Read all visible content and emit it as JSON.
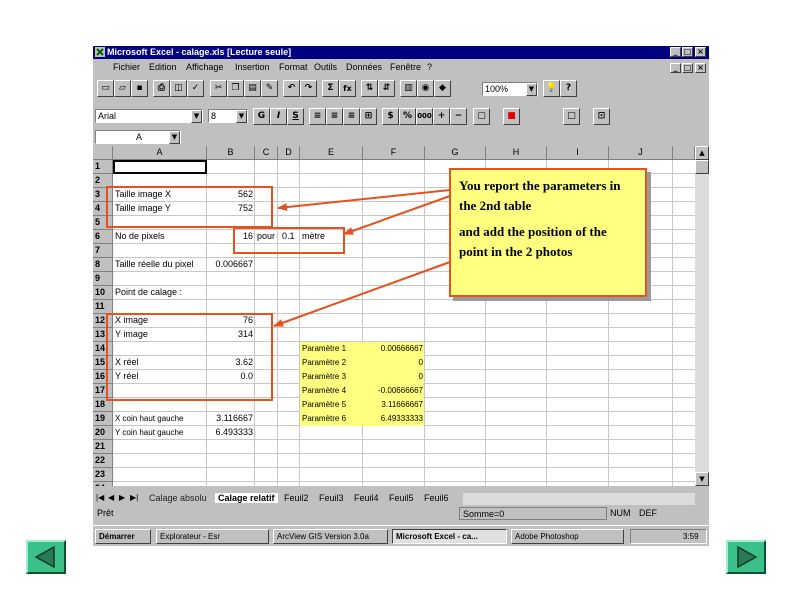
{
  "window": {
    "title": "Microsoft Excel - calage.xls  [Lecture seule]",
    "min_glyph": "_",
    "max_glyph": "□",
    "close_glyph": "×"
  },
  "menu": [
    "Fichier",
    "Edition",
    "Affichage",
    "Insertion",
    "Format",
    "Outils",
    "Données",
    "Fenêtre",
    "?"
  ],
  "toolbar": {
    "zoom": "100%",
    "sum": "Σ",
    "fx": "fx",
    "help": "?"
  },
  "format": {
    "font": "Arial",
    "size": "8",
    "bold": "G",
    "italic": "I",
    "underline": "S",
    "percent": "%",
    "thousands": "000"
  },
  "formula": {
    "cell_ref": "A"
  },
  "columns": [
    "A",
    "B",
    "C",
    "D",
    "E",
    "F",
    "G",
    "H",
    "I",
    "J"
  ],
  "rows": [
    "1",
    "2",
    "3",
    "4",
    "5",
    "6",
    "7",
    "8",
    "9",
    "10",
    "11",
    "12",
    "13",
    "14",
    "15",
    "16",
    "17",
    "18",
    "19",
    "20",
    "21",
    "22",
    "23",
    "24"
  ],
  "cells": {
    "a3": "Taille image X",
    "b3": "562",
    "a4": "Taille image Y",
    "b4": "752",
    "a6": "No de pixels",
    "b6": "16",
    "c6": "pour",
    "d6": "0.1",
    "e6": "mètre",
    "a8": "Taille réelle du pixel",
    "b8": "0.006667",
    "a10": "Point de calage :",
    "a12": "X image",
    "b12": "76",
    "a13": "Y image",
    "b13": "314",
    "a15": "X réel",
    "b15": "3.62",
    "a16": "Y réel",
    "b16": "0.0",
    "a19": "X coin haut gauche",
    "b19": "3.116667",
    "a20": "Y coin haut gauche",
    "b20": "6.493333",
    "e14": "Paramètre 1",
    "f14": "0.00666667",
    "e15": "Paramètre 2",
    "f15": "0",
    "e16": "Paramètre 3",
    "f16": "0",
    "e17": "Paramètre 4",
    "f17": "-0.00666667",
    "e18": "Paramètre 5",
    "f18": "3.11666667",
    "e19": "Paramètre 6",
    "f19": "6.49333333"
  },
  "sheet_tabs": [
    "Calage absolu",
    "Calage relatif",
    "Feuil2",
    "Feuil3",
    "Feuil4",
    "Feuil5",
    "Feuil6"
  ],
  "status": {
    "ready": "Prêt",
    "sum": "Somme=0",
    "num": "NUM",
    "def": "DEF"
  },
  "taskbar": {
    "start": "Démarrer",
    "tasks": [
      "Explorateur - Esr",
      "ArcView GIS Version 3.0a",
      "Microsoft Excel - ca...",
      "Adobe Photoshop"
    ],
    "clock": "3:59"
  },
  "callout": {
    "line1": "You report the parameters in the 2nd table",
    "line2": "and add the position of the point in the 2 photos"
  },
  "colors": {
    "arrow": "#e8501e",
    "callout_bg": "#ffff80",
    "nav": "#3cc08a"
  }
}
